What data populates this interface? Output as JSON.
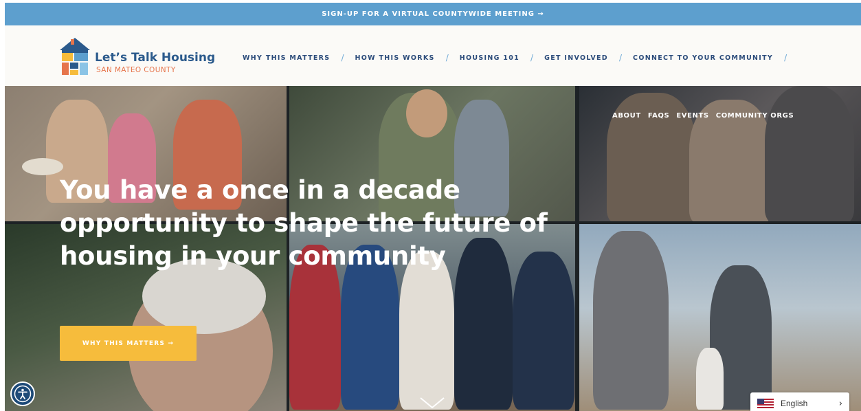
{
  "banner": {
    "text": "SIGN-UP FOR A VIRTUAL COUNTYWIDE MEETING →"
  },
  "logo": {
    "title": "Let’s Talk Housing",
    "subtitle": "SAN MATEO COUNTY"
  },
  "main_nav": {
    "items": [
      {
        "label": "WHY THIS MATTERS"
      },
      {
        "label": "HOW THIS WORKS"
      },
      {
        "label": "HOUSING 101"
      },
      {
        "label": "GET INVOLVED"
      },
      {
        "label": "CONNECT TO YOUR COMMUNITY"
      }
    ],
    "separator": "/"
  },
  "secondary_nav": {
    "items": [
      {
        "label": "ABOUT"
      },
      {
        "label": "FAQS"
      },
      {
        "label": "EVENTS"
      },
      {
        "label": "COMMUNITY ORGS"
      }
    ]
  },
  "hero": {
    "heading": "You have a once in a decade opportunity to shape the future of housing in your community",
    "cta_label": "WHY THIS MATTERS →"
  },
  "language": {
    "label": "English",
    "chevron": "›"
  },
  "icons": {
    "accessibility": "accessibility-icon",
    "scroll": "chevron-down-icon",
    "flag": "us-flag-icon"
  },
  "colors": {
    "banner": "#5d9fce",
    "nav_text": "#2b4b7a",
    "nav_separator": "#6fa9d6",
    "logo_title": "#2b5a8c",
    "logo_subtitle": "#e6754c",
    "cta": "#f6bc3c",
    "accessibility_button": "#1d4a78"
  }
}
